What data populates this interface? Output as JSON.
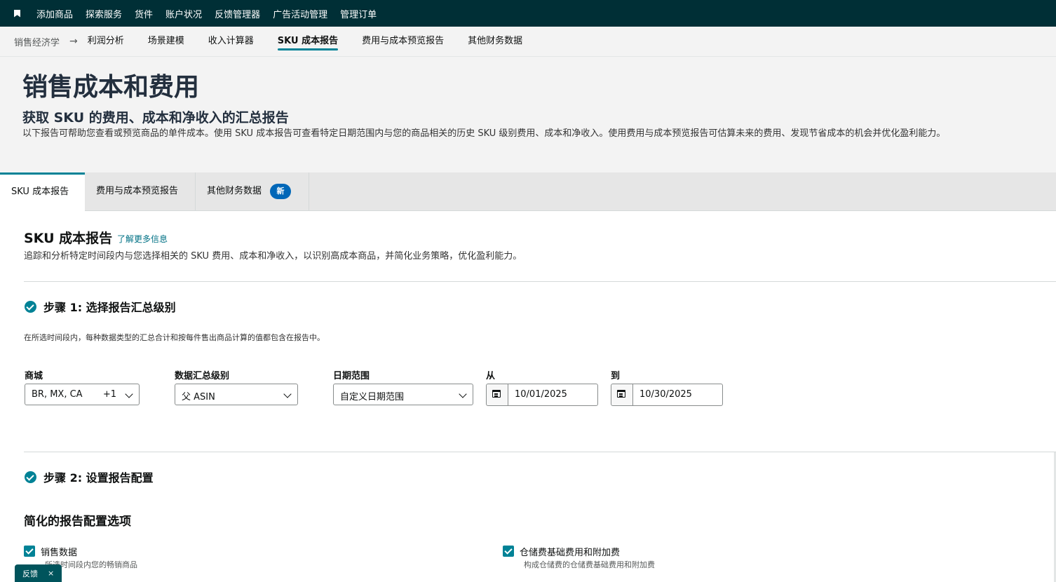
{
  "topnav": {
    "items": [
      "添加商品",
      "探索服务",
      "货件",
      "账户状况",
      "反馈管理器",
      "广告活动管理",
      "管理订单"
    ]
  },
  "subnav": {
    "crumb": "销售经济学",
    "items": [
      "利润分析",
      "场景建模",
      "收入计算器",
      "SKU 成本报告",
      "费用与成本预览报告",
      "其他财务数据"
    ],
    "active": "SKU 成本报告"
  },
  "header": {
    "title": "销售成本和费用",
    "subtitle": "获取 SKU 的费用、成本和净收入的汇总报告",
    "description": "以下报告可帮助您查看或预览商品的单件成本。使用 SKU 成本报告可查看特定日期范围内与您的商品相关的历史 SKU 级别费用、成本和净收入。使用费用与成本预览报告可估算未来的费用、发现节省成本的机会并优化盈利能力。"
  },
  "tabs": [
    {
      "label": "SKU 成本报告"
    },
    {
      "label": "费用与成本预览报告"
    },
    {
      "label": "其他财务数据",
      "badge": "新"
    }
  ],
  "section": {
    "title": "SKU 成本报告",
    "learn_more": "了解更多信息",
    "description": "追踪和分析特定时间段内与您选择相关的 SKU 费用、成本和净收入，以识别高成本商品，并简化业务策略，优化盈利能力。"
  },
  "step1": {
    "title": "步骤 1:  选择报告汇总级别",
    "description": "在所选时间段内，每种数据类型的汇总合计和按每件售出商品计算的值都包含在报告中。",
    "marketplace": {
      "label": "商城",
      "value": "BR, MX, CA",
      "extra": "+1"
    },
    "aggregation": {
      "label": "数据汇总级别",
      "value": "父 ASIN"
    },
    "date_range": {
      "label": "日期范围",
      "value": "自定义日期范围"
    },
    "from": {
      "label": "从",
      "value": "10/01/2025"
    },
    "to": {
      "label": "到",
      "value": "10/30/2025"
    }
  },
  "step2": {
    "title": "步骤 2:  设置报告配置",
    "config_title": "简化的报告配置选项",
    "options": [
      {
        "label": "销售数据",
        "sub": "所选时间段内您的畅销商品"
      },
      {
        "label": "仓储费基础费用和附加费",
        "sub": "构成仓储费的仓储费基础费用和附加费"
      }
    ]
  },
  "feedback": {
    "label": "反馈",
    "close": "×"
  },
  "colors": {
    "nav_bg": "#002f36",
    "accent": "#008296",
    "badge": "#0067b8",
    "link": "#007185"
  }
}
